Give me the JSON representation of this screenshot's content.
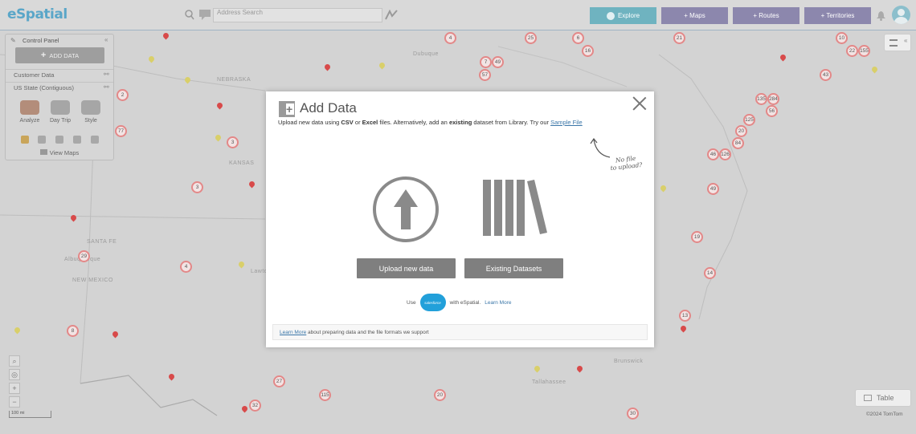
{
  "header": {
    "logo": "eSpatial",
    "search_placeholder": "Address Search",
    "nav": {
      "explore": "Explore",
      "maps": "+ Maps",
      "routes": "+ Routes",
      "territories": "+ Territories"
    }
  },
  "control_panel": {
    "title": "Control Panel",
    "add_data": "ADD DATA",
    "layers": [
      "Customer Data",
      "US State (Contiguous)"
    ],
    "tools": [
      "Analyze",
      "Day Trip",
      "Style"
    ],
    "view_maps": "View Maps"
  },
  "map": {
    "labels": [
      "NEBRASKA",
      "KANSAS",
      "NEW MEXICO",
      "SANTA FE",
      "Albuquerque",
      "Dubuque",
      "Lawton",
      "Brunswick",
      "Tallahassee"
    ],
    "scale": "100 mi",
    "copyright": "©2024 TomTom",
    "table_button": "Table"
  },
  "modal": {
    "title": "Add Data",
    "subtitle_parts": {
      "pre": "Upload new data using ",
      "csv": "CSV",
      "or": " or ",
      "excel": "Excel",
      "mid": " files. Alternatively, add an ",
      "existing": "existing",
      "post": " dataset from Library. Try our ",
      "sample_link": "Sample File"
    },
    "note_line1": "No file",
    "note_line2": "to upload?",
    "upload_button": "Upload new data",
    "existing_button": "Existing Datasets",
    "salesforce": {
      "use": "Use",
      "logo": "salesforce",
      "with": "with eSpatial.",
      "learn_more": "Learn More"
    },
    "footer": {
      "link": "Learn More",
      "text": " about preparing data and the file formats we support"
    }
  },
  "colors": {
    "explore": "#6fb3c0",
    "nav": "#8c87ad",
    "cluster_ring": "#e38888",
    "pin_red": "#d84a4a",
    "pin_yellow": "#d9cf6a"
  }
}
